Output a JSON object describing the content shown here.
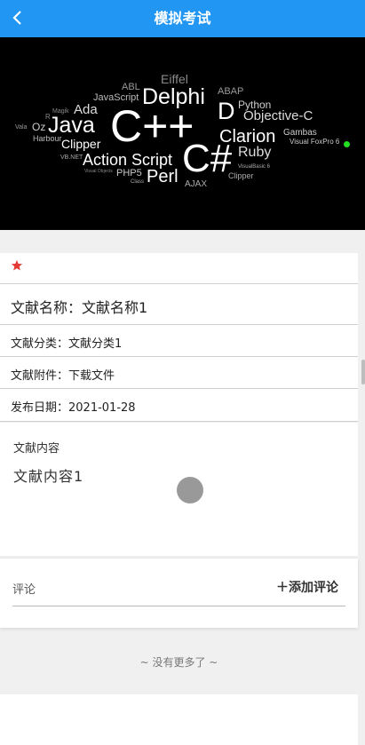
{
  "header": {
    "title": "模拟考试"
  },
  "banner": {
    "words": [
      "Eiffel",
      "ABL",
      "ABAP",
      "JavaScript",
      "Delphi",
      "Python",
      "Magik",
      "Ada",
      "D",
      "Objective-C",
      "Oz",
      "R",
      "Vala",
      "Java",
      "C++",
      "Harbour",
      "Clarion",
      "Gambas",
      "Clipper",
      "Visual FoxPro 6",
      "VB.NET",
      "Action Script",
      "C#",
      "Ruby",
      "Visual Objects",
      "PHP5",
      "Perl",
      "VisualBasic 6",
      "Class",
      "AJAX",
      "Clipper"
    ]
  },
  "detail": {
    "name": "文献名称：文献名称1",
    "category": "文献分类：文献分类1",
    "attachment_label": "文献附件：",
    "attachment_link": "下载文件",
    "date": "发布日期：2021-01-28"
  },
  "content": {
    "heading": "文献内容",
    "text": "文献内容1"
  },
  "comments": {
    "label": "评论",
    "add": "＋添加评论"
  },
  "list": {
    "no_more": "~ 没有更多了 ~"
  },
  "colors": {
    "header": "#2196f3",
    "star": "#e53935"
  }
}
